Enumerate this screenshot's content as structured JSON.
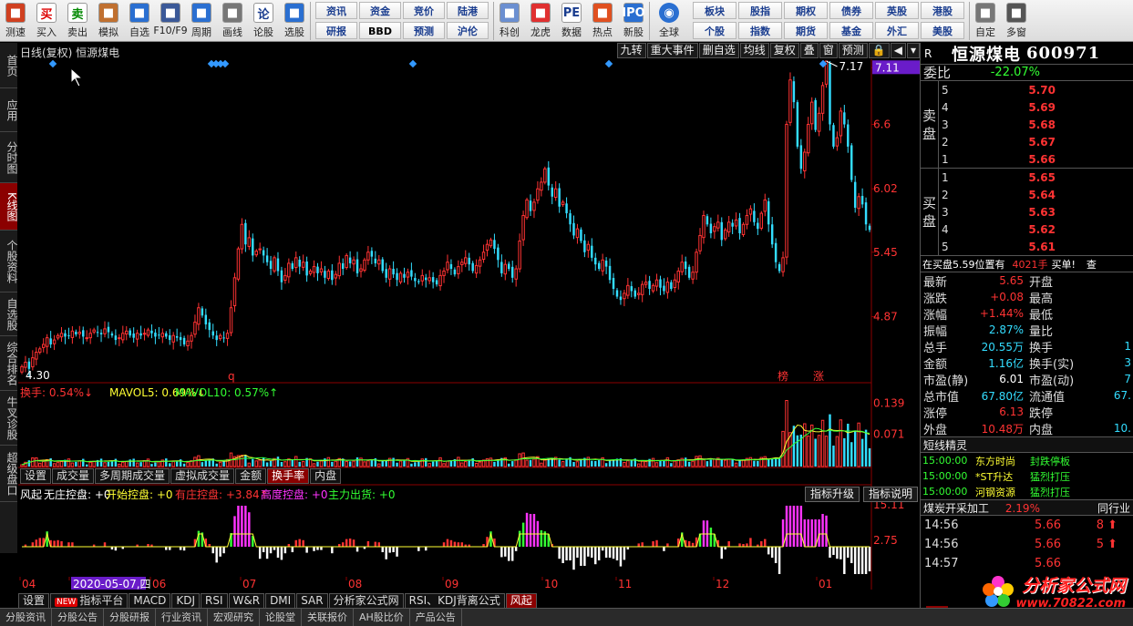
{
  "toolbar": {
    "left_items": [
      {
        "label": "测速",
        "icon": "clock-icon"
      },
      {
        "label": "买入",
        "icon": "buy-icon",
        "glyph": "买"
      },
      {
        "label": "卖出",
        "icon": "sell-icon",
        "glyph": "卖"
      },
      {
        "label": "模拟",
        "icon": "hammer-icon"
      },
      {
        "label": "自选",
        "icon": "star-icon"
      },
      {
        "label": "F10/F9",
        "icon": "document-icon"
      },
      {
        "label": "周期",
        "icon": "cycle-icon"
      },
      {
        "label": "画线",
        "icon": "pencil-icon"
      },
      {
        "label": "论股",
        "icon": "discuss-icon",
        "glyph": "论"
      },
      {
        "label": "选股",
        "icon": "select-stock-icon"
      }
    ],
    "text_group_1": [
      "资讯",
      "资金",
      "竞价",
      "陆港",
      "研报",
      "BBD",
      "预测",
      "沪伦"
    ],
    "mid_items": [
      {
        "label": "科创",
        "icon": "chart-icon"
      },
      {
        "label": "龙虎",
        "icon": "dragon-icon"
      },
      {
        "label": "数据",
        "icon": "pe-icon",
        "glyph": "PE"
      },
      {
        "label": "热点",
        "icon": "hot-icon"
      },
      {
        "label": "新股",
        "icon": "ipo-icon",
        "glyph": "IPO"
      }
    ],
    "globe_label": "全球",
    "text_group_2": [
      "板块",
      "股指",
      "期权",
      "债券",
      "英股",
      "港股",
      "个股",
      "指数",
      "期货",
      "基金",
      "外汇",
      "美股"
    ],
    "right_items": [
      {
        "label": "自定",
        "icon": "custom-icon"
      },
      {
        "label": "多窗",
        "icon": "multi-window-icon"
      }
    ]
  },
  "left_tabs": [
    {
      "label": "首页",
      "active": false
    },
    {
      "label": "应用",
      "active": false
    },
    {
      "label": "分时图",
      "active": false
    },
    {
      "label": "K线图",
      "active": true
    },
    {
      "label": "个股资料",
      "active": false
    },
    {
      "label": "自选股",
      "active": false
    },
    {
      "label": "综合排名",
      "active": false
    },
    {
      "label": "牛叉诊股",
      "active": false
    },
    {
      "label": "超级盘口",
      "active": false
    }
  ],
  "chart_header": {
    "title": "日线(复权) 恒源煤电",
    "tabs": [
      "九转",
      "重大事件",
      "删自选",
      "均线",
      "复权",
      "叠",
      "窗",
      "预测"
    ]
  },
  "indicator_tabs": [
    {
      "label": "设置",
      "active": false
    },
    {
      "label": "成交量",
      "active": false
    },
    {
      "label": "多周期成交量",
      "active": false
    },
    {
      "label": "虚拟成交量",
      "active": false
    },
    {
      "label": "金额",
      "active": false
    },
    {
      "label": "换手率",
      "active": true
    },
    {
      "label": "内盘",
      "active": false
    }
  ],
  "indicator3_buttons": [
    "指标升级",
    "指标说明"
  ],
  "bottom_tabs": [
    {
      "label": "设置",
      "new": false,
      "active": false
    },
    {
      "label": "指标平台",
      "new": true,
      "active": false
    },
    {
      "label": "MACD",
      "new": false,
      "active": false
    },
    {
      "label": "KDJ",
      "new": false,
      "active": false
    },
    {
      "label": "RSI",
      "new": false,
      "active": false
    },
    {
      "label": "W&R",
      "new": false,
      "active": false
    },
    {
      "label": "DMI",
      "new": false,
      "active": false
    },
    {
      "label": "SAR",
      "new": false,
      "active": false
    },
    {
      "label": "分析家公式网",
      "new": false,
      "active": false
    },
    {
      "label": "RSI、KDJ背离公式",
      "new": false,
      "active": false
    },
    {
      "label": "风起",
      "new": false,
      "active": true
    }
  ],
  "new_badge": "NEW",
  "chart_data": [
    {
      "type": "candlestick",
      "title": "日线(复权) 恒源煤电",
      "y_ticks": [
        4.87,
        5.45,
        6.02,
        6.6,
        7.11
      ],
      "ylim": [
        4.3,
        7.17
      ],
      "current_price_label": "7.11",
      "high_label": "7.17",
      "low_label": "4.30",
      "annotations": [
        "q",
        "榜",
        "涨"
      ],
      "month_labels": [
        "04",
        "05",
        "06",
        "07",
        "08",
        "09",
        "10",
        "11",
        "12",
        "01"
      ],
      "cursor_date": "2020-05-07,四",
      "up_color": "#ff3333",
      "down_color": "#33ddff",
      "close": [
        4.42,
        4.46,
        4.4,
        4.5,
        4.55,
        4.58,
        4.62,
        4.68,
        4.62,
        4.66,
        4.7,
        4.72,
        4.69,
        4.7,
        4.74,
        4.71,
        4.73,
        4.69,
        4.68,
        4.72,
        4.75,
        4.73,
        4.71,
        4.76,
        4.73,
        4.7,
        4.66,
        4.68,
        4.72,
        4.74,
        4.7,
        4.68,
        4.72,
        4.7,
        4.72,
        4.75,
        4.72,
        4.69,
        4.7,
        4.72,
        4.69,
        4.66,
        4.7,
        4.68,
        4.66,
        4.62,
        4.65,
        4.7,
        4.82,
        4.95,
        4.88,
        4.8,
        4.75,
        4.7,
        4.66,
        4.7,
        4.68,
        4.72,
        4.95,
        5.22,
        5.48,
        5.7,
        5.52,
        5.58,
        5.42,
        5.46,
        5.48,
        5.42,
        5.36,
        5.3,
        5.4,
        5.28,
        5.18,
        5.24,
        5.35,
        5.3,
        5.4,
        5.32,
        5.36,
        5.24,
        5.28,
        5.32,
        5.26,
        5.3,
        5.22,
        5.28,
        5.2,
        5.25,
        5.35,
        5.3,
        5.42,
        5.35,
        5.38,
        5.26,
        5.3,
        5.38,
        5.45,
        5.41,
        5.35,
        5.38,
        5.28,
        5.22,
        5.3,
        5.25,
        5.2,
        5.26,
        5.22,
        5.27,
        5.23,
        5.19,
        5.18,
        5.24,
        5.2,
        5.22,
        5.18,
        5.16,
        5.24,
        5.28,
        5.36,
        5.3,
        5.25,
        5.32,
        5.36,
        5.4,
        5.34,
        5.28,
        5.33,
        5.38,
        5.45,
        5.52,
        5.56,
        5.48,
        5.38,
        5.26,
        5.34,
        5.3,
        5.22,
        5.3,
        5.55,
        5.78,
        5.92,
        5.82,
        5.9,
        6.02,
        6.08,
        6.2,
        6.05,
        5.95,
        6.02,
        5.86,
        5.9,
        5.8,
        5.7,
        5.6,
        5.66,
        5.55,
        5.45,
        5.52,
        5.4,
        5.34,
        5.3,
        5.38,
        5.32,
        5.2,
        5.12,
        5.05,
        5.02,
        5.08,
        5.15,
        5.1,
        5.05,
        5.08,
        5.16,
        5.18,
        5.12,
        5.15,
        5.2,
        5.13,
        5.1,
        5.18,
        5.12,
        5.2,
        5.28,
        5.36,
        5.3,
        5.22,
        5.27,
        5.45,
        5.6,
        5.78,
        5.7,
        5.62,
        5.68,
        5.72,
        5.56,
        5.65,
        5.72,
        5.68,
        5.74,
        5.62,
        5.7,
        5.78,
        5.84,
        5.72,
        5.66,
        5.8,
        5.92,
        5.7,
        5.52,
        5.36,
        5.28,
        5.4,
        6.6,
        7.0,
        6.8,
        6.4,
        6.2,
        6.35,
        6.6,
        6.8,
        6.55,
        6.7,
        6.95,
        7.17,
        6.6,
        6.4,
        6.48,
        6.72,
        6.6,
        6.4,
        6.1,
        5.85,
        5.95,
        5.88,
        5.7,
        5.65
      ],
      "volume_labels": {
        "turnover": "换手: 0.54%↓",
        "mavol5": "MAVOL5: 0.69%↓",
        "mavol10": "MAVOL10: 0.57%↑"
      },
      "vol_ticks": [
        0.071,
        0.139
      ]
    },
    {
      "type": "bar",
      "title": "风起",
      "labels": {
        "a": "无庄控盘: +0",
        "b": "开始控盘: +0",
        "c": "有庄控盘: +3.84↑",
        "d": "高度控盘: +0",
        "e": "主力出货: +0"
      },
      "label_colors": {
        "a": "#ffffff",
        "b": "#ffff33",
        "c": "#ff3333",
        "d": "#ff33ff",
        "e": "#33ff33"
      },
      "y_ticks": [
        2.75,
        15.11
      ]
    }
  ],
  "right_panel": {
    "r_label": "R",
    "stock_name": "恒源煤电",
    "stock_code": "600971",
    "webi_label": "委比",
    "webi_value": "-22.07%",
    "sell_label": "卖盘",
    "buy_label": "买盘",
    "sell_orders": [
      {
        "level": "5",
        "price": "5.70"
      },
      {
        "level": "4",
        "price": "5.69"
      },
      {
        "level": "3",
        "price": "5.68"
      },
      {
        "level": "2",
        "price": "5.67"
      },
      {
        "level": "1",
        "price": "5.66"
      }
    ],
    "buy_orders": [
      {
        "level": "1",
        "price": "5.65"
      },
      {
        "level": "2",
        "price": "5.64"
      },
      {
        "level": "3",
        "price": "5.63"
      },
      {
        "level": "4",
        "price": "5.62"
      },
      {
        "level": "5",
        "price": "5.61"
      }
    ],
    "buy_note": "在买盘5.59位置有",
    "buy_note_qty": "4021手",
    "buy_note_tail": "买单!",
    "buy_note_more": "查",
    "quote_left": [
      {
        "k": "最新",
        "v": "5.65",
        "c": "red"
      },
      {
        "k": "涨跌",
        "v": "+0.08",
        "c": "red"
      },
      {
        "k": "涨幅",
        "v": "+1.44%",
        "c": "red"
      },
      {
        "k": "振幅",
        "v": "2.87%",
        "c": "cyan"
      },
      {
        "k": "总手",
        "v": "20.55万",
        "c": "cyan"
      },
      {
        "k": "金额",
        "v": "1.16亿",
        "c": "cyan"
      },
      {
        "k": "市盈(静)",
        "v": "6.01",
        "c": "white"
      },
      {
        "k": "总市值",
        "v": "67.80亿",
        "c": "cyan"
      },
      {
        "k": "涨停",
        "v": "6.13",
        "c": "red"
      },
      {
        "k": "外盘",
        "v": "10.48万",
        "c": "red"
      }
    ],
    "quote_right": [
      {
        "k": "开盘",
        "v": ""
      },
      {
        "k": "最高",
        "v": ""
      },
      {
        "k": "最低",
        "v": ""
      },
      {
        "k": "量比",
        "v": ""
      },
      {
        "k": "换手",
        "v": "1"
      },
      {
        "k": "换手(实)",
        "v": "3"
      },
      {
        "k": "市盈(动)",
        "v": "7"
      },
      {
        "k": "流通值",
        "v": "67."
      },
      {
        "k": "跌停",
        "v": ""
      },
      {
        "k": "内盘",
        "v": "10."
      }
    ],
    "short_title": "短线精灵",
    "short_news": [
      {
        "time": "15:00:00",
        "stock": "东方时尚",
        "desc": "封跌停板"
      },
      {
        "time": "15:00:00",
        "stock": "*ST升达",
        "desc": "猛烈打压"
      },
      {
        "time": "15:00:00",
        "stock": "河钢资源",
        "desc": "猛烈打压"
      }
    ],
    "sector_name": "煤炭开采加工",
    "sector_change": "2.19%",
    "sector_more": "同行业",
    "ticks": [
      {
        "time": "14:56",
        "price": "5.66",
        "vol": "8",
        "dir": "up"
      },
      {
        "time": "14:56",
        "price": "5.66",
        "vol": "5",
        "dir": "up"
      },
      {
        "time": "14:57",
        "price": "5.66",
        "vol": "",
        "dir": ""
      }
    ],
    "bottom_tag": "细"
  },
  "status_bar": [
    "分股资讯",
    "分股公告",
    "分股研报",
    "行业资讯",
    "宏观研究",
    "论股堂",
    "关联报价",
    "AH股比价",
    "产品公告"
  ],
  "watermark": {
    "text": "分析家公式网",
    "url": "www.70822.com"
  }
}
